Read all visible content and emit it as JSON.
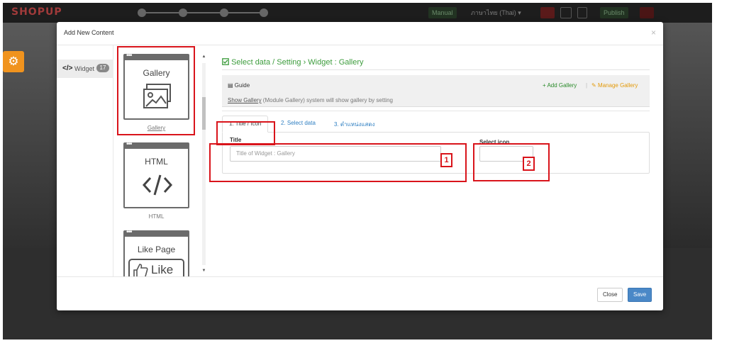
{
  "app": {
    "brand": "SHOPUP",
    "top_buttons": {
      "manual": "Manual",
      "language": "ภาษาไทย (Thai) ▾",
      "publish": "Publish"
    }
  },
  "modal": {
    "title": "Add New Content",
    "close_symbol": "×",
    "category": {
      "code_icon": "</>",
      "label": "Widget",
      "count": "17"
    },
    "widgets": [
      {
        "title": "Gallery",
        "caption": "Gallery",
        "icon": "gallery-icon"
      },
      {
        "title": "HTML",
        "caption": "HTML",
        "icon": "code-icon"
      },
      {
        "title": "Like Page",
        "caption": "",
        "icon": "thumbs-up-like-icon",
        "icon_text": "Like"
      }
    ],
    "section_heading": "Select data / Setting › Widget : Gallery",
    "guide": {
      "title": "Guide",
      "desc_link": "Show Gallery",
      "desc_rest": " (Module Gallery) system will show gallery by setting",
      "add_gallery": "+ Add Gallery",
      "separator": "|",
      "manage_gallery": "Manage Gallery"
    },
    "tabs": [
      "1. Title / Icon",
      "2. Select data",
      "3. ตำแหน่งแสดง"
    ],
    "form": {
      "title_label": "Title",
      "title_placeholder": "Title of  Widget : Gallery",
      "icon_label": "Select icon"
    },
    "footer": {
      "close": "Close",
      "save": "Save"
    }
  },
  "annotations": [
    "1",
    "2"
  ],
  "colors": {
    "annotation_red": "#d9141b",
    "heading_green": "#3c9c3c",
    "link_blue": "#2f7fc2",
    "manage_orange": "#e39a0a",
    "save_blue": "#4a88c7",
    "gear_orange": "#f0931e"
  }
}
